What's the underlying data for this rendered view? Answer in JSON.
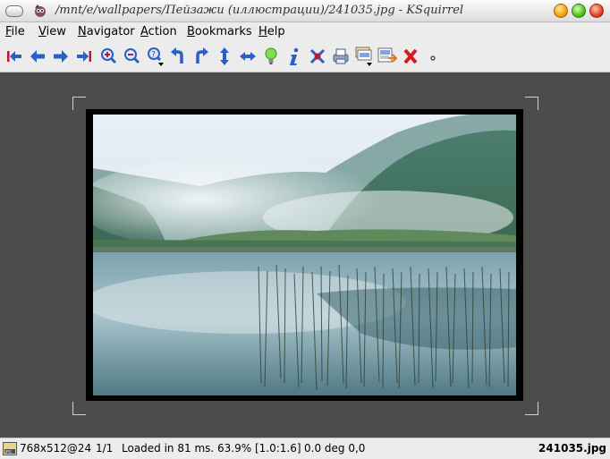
{
  "window": {
    "title": "/mnt/e/wallpapers/Пейзажи (иллюстрации)/241035.jpg - KSquirrel"
  },
  "menu": {
    "items": [
      "File",
      "View",
      "Navigator",
      "Action",
      "Bookmarks",
      "Help"
    ]
  },
  "toolbar": {
    "buttons": [
      {
        "name": "first-image",
        "icon": "go-first-icon"
      },
      {
        "name": "previous-image",
        "icon": "arrow-left-icon"
      },
      {
        "name": "next-image",
        "icon": "arrow-right-icon"
      },
      {
        "name": "last-image",
        "icon": "go-last-icon"
      },
      {
        "name": "zoom-in",
        "icon": "zoom-in-icon"
      },
      {
        "name": "zoom-out",
        "icon": "zoom-out-icon"
      },
      {
        "name": "zoom-menu",
        "icon": "zoom-help-icon"
      },
      {
        "name": "rotate-left",
        "icon": "rotate-left-icon"
      },
      {
        "name": "rotate-right",
        "icon": "rotate-right-icon"
      },
      {
        "name": "flip-vertical",
        "icon": "flip-vertical-icon"
      },
      {
        "name": "flip-horizontal",
        "icon": "flip-horizontal-icon"
      },
      {
        "name": "tips",
        "icon": "lightbulb-icon"
      },
      {
        "name": "image-info",
        "icon": "info-icon"
      },
      {
        "name": "close-image",
        "icon": "remove-icon"
      },
      {
        "name": "print",
        "icon": "printer-icon"
      },
      {
        "name": "image-pages",
        "icon": "pages-icon"
      },
      {
        "name": "send",
        "icon": "send-icon"
      },
      {
        "name": "close-viewer",
        "icon": "red-x-icon"
      },
      {
        "name": "small-indicator",
        "icon": "dot-icon"
      }
    ]
  },
  "status": {
    "dimensions": "768x512@24",
    "page": "1/1",
    "load_info": "Loaded in 81 ms. 63.9% [1.0:1.6]",
    "rotation": "0.0 deg 0,0",
    "filename": "241035.jpg",
    "format_icon": "jpg-file-icon"
  }
}
